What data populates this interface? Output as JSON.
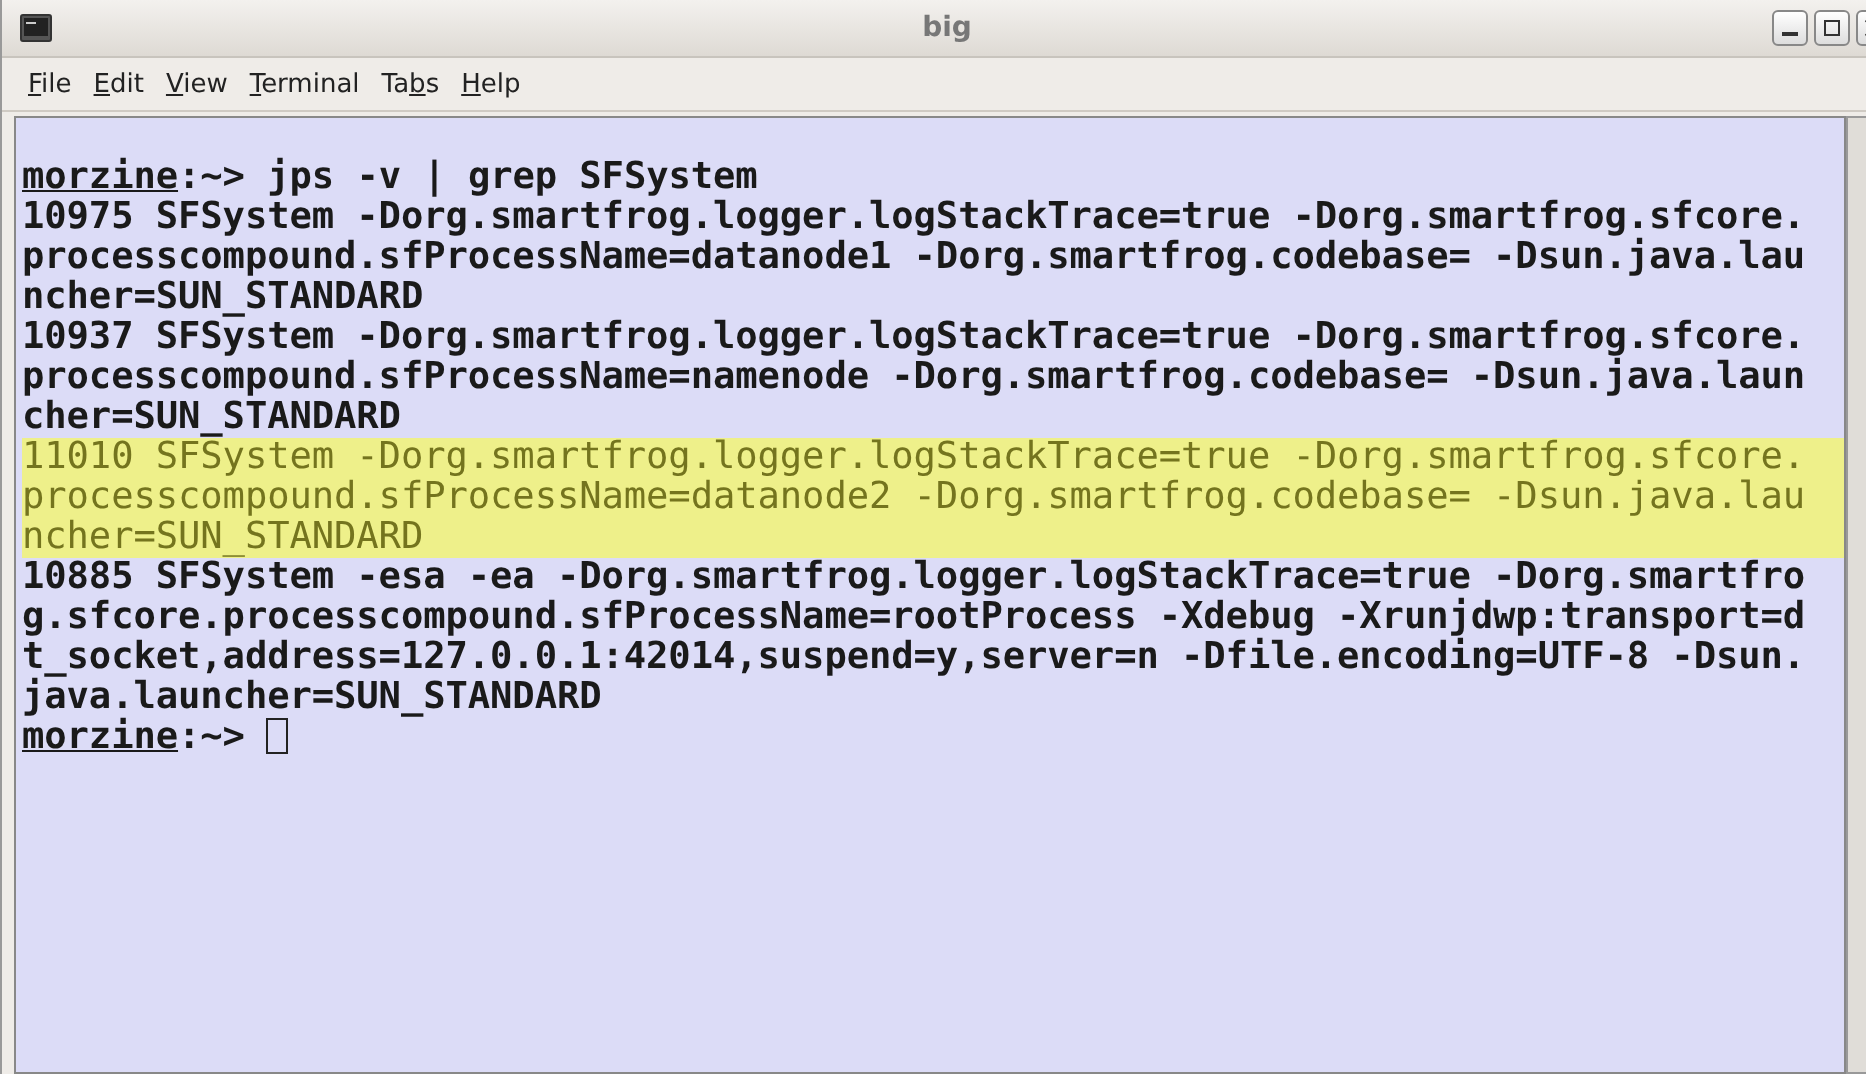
{
  "window": {
    "title": "big"
  },
  "menu": [
    {
      "key": "F",
      "post": "ile"
    },
    {
      "key": "E",
      "post": "dit"
    },
    {
      "key": "V",
      "post": "iew"
    },
    {
      "key": "T",
      "post": "erminal"
    },
    {
      "pre": "Ta",
      "key": "b",
      "post": "s"
    },
    {
      "key": "H",
      "post": "elp"
    }
  ],
  "terminal": {
    "lines": [
      {
        "kind": "prompt",
        "host": "morzine",
        "prompt": ":~>",
        "command": "jps -v | grep SFSystem",
        "cursor": false
      },
      {
        "kind": "output",
        "text": "10975 SFSystem -Dorg.smartfrog.logger.logStackTrace=true -Dorg.smartfrog.sfcore.",
        "highlighted": false
      },
      {
        "kind": "output",
        "text": "processcompound.sfProcessName=datanode1 -Dorg.smartfrog.codebase= -Dsun.java.lau",
        "highlighted": false
      },
      {
        "kind": "output",
        "text": "ncher=SUN_STANDARD",
        "highlighted": false
      },
      {
        "kind": "output",
        "text": "10937 SFSystem -Dorg.smartfrog.logger.logStackTrace=true -Dorg.smartfrog.sfcore.",
        "highlighted": false
      },
      {
        "kind": "output",
        "text": "processcompound.sfProcessName=namenode -Dorg.smartfrog.codebase= -Dsun.java.laun",
        "highlighted": false
      },
      {
        "kind": "output",
        "text": "cher=SUN_STANDARD",
        "highlighted": false
      },
      {
        "kind": "output",
        "text": "11010 SFSystem -Dorg.smartfrog.logger.logStackTrace=true -Dorg.smartfrog.sfcore.",
        "highlighted": true
      },
      {
        "kind": "output",
        "text": "processcompound.sfProcessName=datanode2 -Dorg.smartfrog.codebase= -Dsun.java.lau",
        "highlighted": true
      },
      {
        "kind": "output",
        "text": "ncher=SUN_STANDARD",
        "highlighted": true
      },
      {
        "kind": "output",
        "text": "10885 SFSystem -esa -ea -Dorg.smartfrog.logger.logStackTrace=true -Dorg.smartfro",
        "highlighted": false
      },
      {
        "kind": "output",
        "text": "g.sfcore.processcompound.sfProcessName=rootProcess -Xdebug -Xrunjdwp:transport=d",
        "highlighted": false
      },
      {
        "kind": "output",
        "text": "t_socket,address=127.0.0.1:42014,suspend=y,server=n -Dfile.encoding=UTF-8 -Dsun.",
        "highlighted": false
      },
      {
        "kind": "output",
        "text": "java.launcher=SUN_STANDARD",
        "highlighted": false
      },
      {
        "kind": "prompt",
        "host": "morzine",
        "prompt": ":~>",
        "cursor": true
      }
    ]
  }
}
